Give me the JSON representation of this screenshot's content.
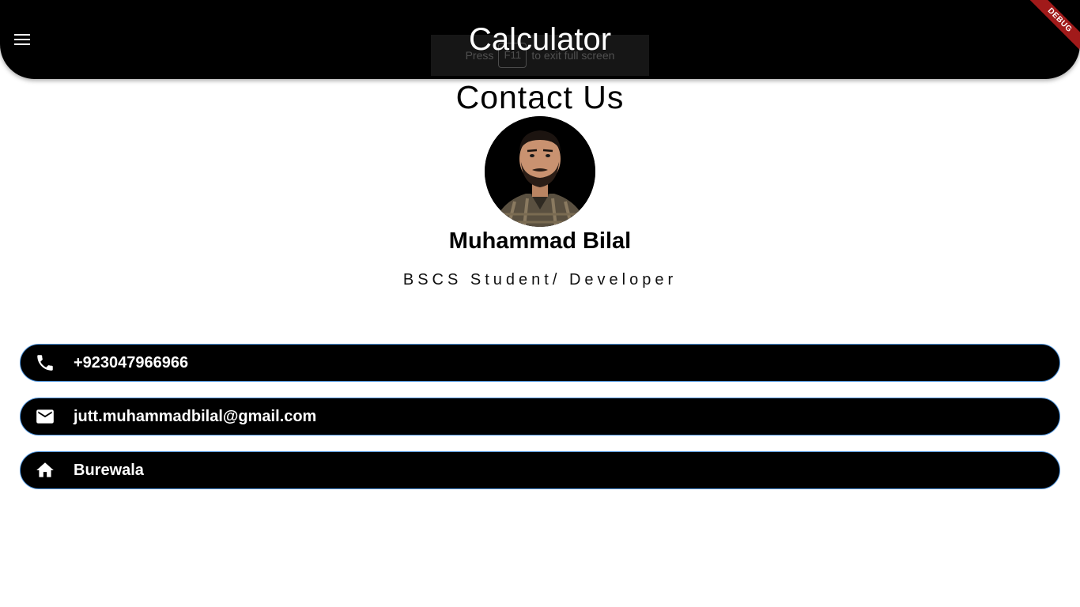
{
  "appbar": {
    "title": "Calculator",
    "menu_icon": "menu-icon",
    "debug_banner": "DEBUG",
    "fullscreen_hint": {
      "prefix": "Press",
      "key": "F11",
      "suffix": "to exit full screen"
    }
  },
  "contact": {
    "heading": "Contact Us",
    "name": "Muhammad Bilal",
    "role": "BSCS Student/ Developer",
    "items": [
      {
        "icon": "phone-icon",
        "text": "+923047966966"
      },
      {
        "icon": "email-icon",
        "text": "jutt.muhammadbilal@gmail.com"
      },
      {
        "icon": "home-icon",
        "text": "Burewala"
      }
    ]
  },
  "colors": {
    "appbar_bg": "#000000",
    "card_bg": "#000000",
    "card_border": "#4a90d9",
    "debug_ribbon": "#a11a1a"
  }
}
